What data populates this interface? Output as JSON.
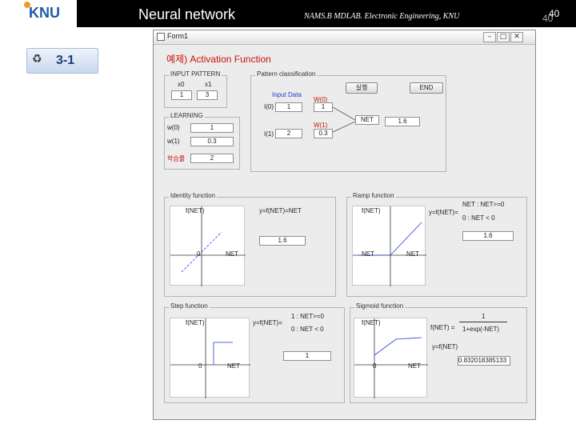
{
  "header": {
    "logo_text": "KNU",
    "title": "Neural network",
    "subtitle": "NAMS.B MDLAB. Electronic Engineering, KNU",
    "page_number": "40",
    "page_number_shadow": "40"
  },
  "section": {
    "icon": "recycle-icon",
    "label": "3-1"
  },
  "window": {
    "title": "Form1",
    "heading": "예제) Activation Function",
    "input_pattern": {
      "label": "INPUT PATTERN",
      "col_labels": [
        "x0",
        "x1"
      ],
      "values": [
        "1",
        "3"
      ]
    },
    "learning": {
      "label": "LEARNING",
      "w0_label": "w(0)",
      "w0_value": "1",
      "w1_label": "w(1)",
      "w1_value": "0.3",
      "rate_label": "학습률",
      "rate_value": "2"
    },
    "pattern": {
      "label": "Pattern classification",
      "run_button": "실행",
      "end_button": "END",
      "input_data_label": "Input Data",
      "i0_label": "I(0)",
      "i0_value": "1",
      "i1_label": "I(1)",
      "i1_value": "2",
      "w0_label": "W(0)",
      "w0_value": "1",
      "w1_label": "W(1)",
      "w1_value": "0.3",
      "net_label": "NET",
      "net_value": "1.6"
    },
    "identity": {
      "label": "Identity function",
      "y_axis": "f(NET)",
      "x_axis": "NET",
      "zero": "0",
      "formula": "y=f(NET)=NET",
      "output": "1.6"
    },
    "ramp": {
      "label": "Ramp function",
      "y_axis": "f(NET)",
      "x_axis": "NET",
      "zero": "NET",
      "formula_y": "y=f(NET)=",
      "case1": "NET : NET>=0",
      "case2": "0 : NET < 0",
      "output": "1.6"
    },
    "step": {
      "label": "Step function",
      "y_axis": "f(NET)",
      "x_axis": "NET",
      "zero": "0",
      "formula_y": "y=f(NET)=",
      "case1": "1 : NET>=0",
      "case2": "0 : NET < 0",
      "output": "1"
    },
    "sigmoid": {
      "label": "Sigmoid function",
      "y_axis": "f(NET)",
      "x_axis": "NET",
      "zero": "0",
      "formula_lhs": "f(NET) =",
      "numerator": "1",
      "denominator": "1+exp(-NET)",
      "y_label": "y=f(NET)",
      "output": "0.832018385133"
    }
  }
}
